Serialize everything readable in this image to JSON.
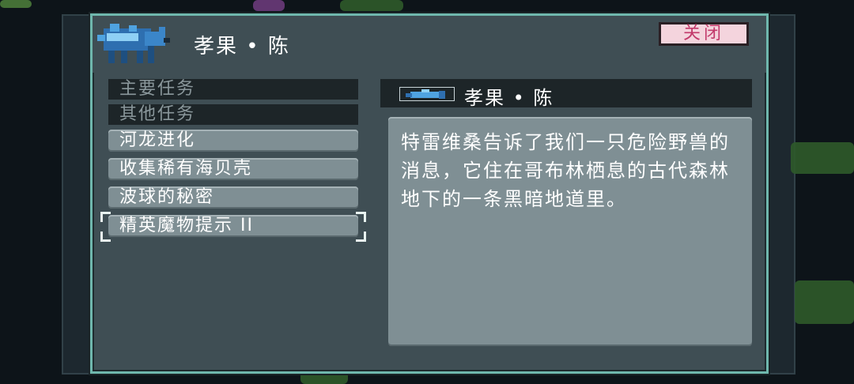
{
  "dialog": {
    "title": "孝果 • 陈",
    "close_label": "关闭"
  },
  "quest_list": {
    "headers": [
      "主要任务",
      "其他任务"
    ],
    "items": [
      {
        "label": "河龙进化"
      },
      {
        "label": "收集稀有海贝壳"
      },
      {
        "label": "波球的秘密"
      },
      {
        "label": "精英魔物提示 II"
      }
    ],
    "selected_index": 3
  },
  "detail": {
    "name": "孝果 • 陈",
    "description": "特雷维桑告诉了我们一只危险野兽的消息，它住在哥布林栖息的古代森林地下的一条黑暗地道里。"
  },
  "colors": {
    "frame_accent": "#6fb7ad",
    "close_text": "#c23a6b",
    "close_bg": "#f4d4dd"
  },
  "icons": {
    "avatar": "blue-wolf-creature-icon",
    "detail": "fish-creature-icon"
  }
}
